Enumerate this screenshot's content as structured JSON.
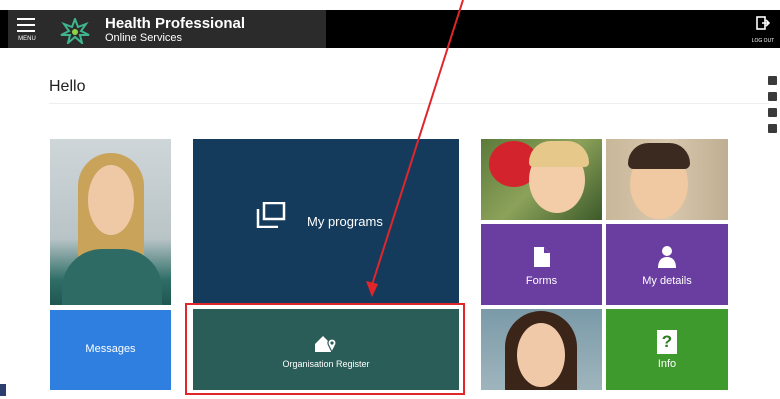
{
  "header": {
    "menu_label": "MENU",
    "brand_title": "Health Professional",
    "brand_subtitle": "Online Services",
    "logout_label": "LOG OUT"
  },
  "greeting": "Hello",
  "tiles": {
    "programs": "My programs",
    "messages": "Messages",
    "organisation_register": "Organisation Register",
    "forms": "Forms",
    "my_details": "My details",
    "info": "Info",
    "info_glyph": "?"
  },
  "colors": {
    "programs": "#153b5c",
    "messages": "#2f7fe0",
    "organisation_register": "#2a5c58",
    "forms": "#6a3ea1",
    "my_details": "#6a3ea1",
    "info": "#3f9a2d",
    "annotation": "#e0262b"
  },
  "icons": {
    "menu": "hamburger-icon",
    "logo": "star-logo-icon",
    "logout": "logout-icon",
    "programs": "copy-windows-icon",
    "organisation_register": "house-location-icon",
    "forms": "document-icon",
    "my_details": "person-icon",
    "info": "question-icon"
  }
}
